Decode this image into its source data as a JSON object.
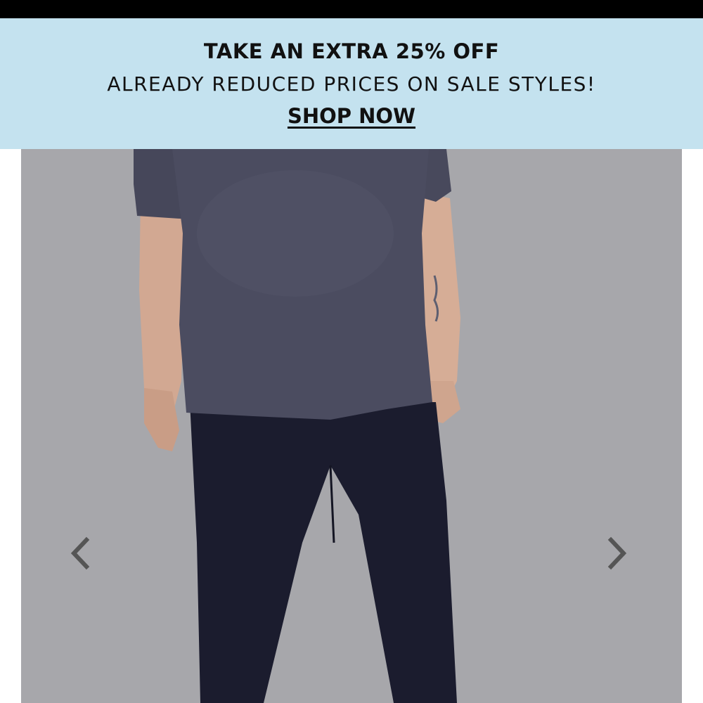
{
  "promo": {
    "headline": "TAKE AN EXTRA 25% OFF",
    "subline": "ALREADY REDUCED PRICES ON SALE STYLES!",
    "cta": "SHOP NOW",
    "background": "#c4e2ef"
  },
  "gallery": {
    "image_subject": "model wearing dark grey maternity top and navy pants",
    "prev_icon": "chevron-left-icon",
    "next_icon": "chevron-right-icon"
  }
}
